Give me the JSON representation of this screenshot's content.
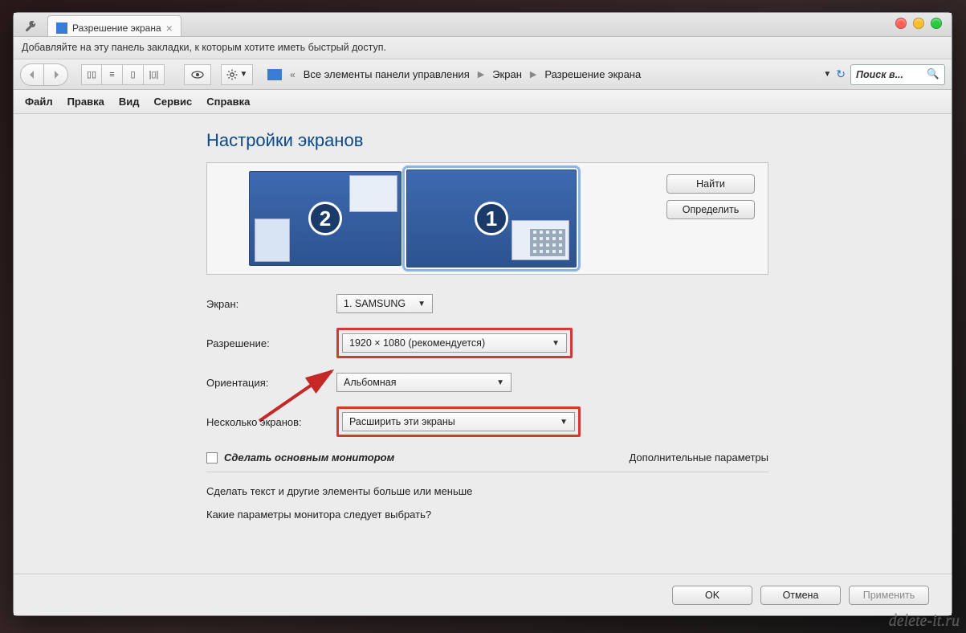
{
  "browser": {
    "tab_title": "Разрешение экрана",
    "bookmarks_hint": "Добавляйте на эту панель закладки, к которым хотите иметь быстрый доступ."
  },
  "toolbar": {
    "breadcrumb": {
      "item1": "Все элементы панели управления",
      "item2": "Экран",
      "item3": "Разрешение экрана"
    },
    "search_placeholder": "Поиск в..."
  },
  "menu": {
    "file": "Файл",
    "edit": "Правка",
    "view": "Вид",
    "service": "Сервис",
    "help": "Справка"
  },
  "page": {
    "title": "Настройки экранов",
    "find_btn": "Найти",
    "identify_btn": "Определить",
    "monitor2_num": "2",
    "monitor1_num": "1",
    "labels": {
      "screen": "Экран:",
      "resolution": "Разрешение:",
      "orientation": "Ориентация:",
      "multiple": "Несколько экранов:"
    },
    "values": {
      "screen": "1. SAMSUNG",
      "resolution": "1920 × 1080 (рекомендуется)",
      "orientation": "Альбомная",
      "multiple": "Расширить эти экраны"
    },
    "make_primary": "Сделать основным монитором",
    "advanced": "Дополнительные параметры",
    "link_textsize": "Сделать текст и другие элементы больше или меньше",
    "link_which": "Какие параметры монитора следует выбрать?",
    "ok": "OK",
    "cancel": "Отмена",
    "apply": "Применить"
  },
  "watermark": "delete-it.ru"
}
